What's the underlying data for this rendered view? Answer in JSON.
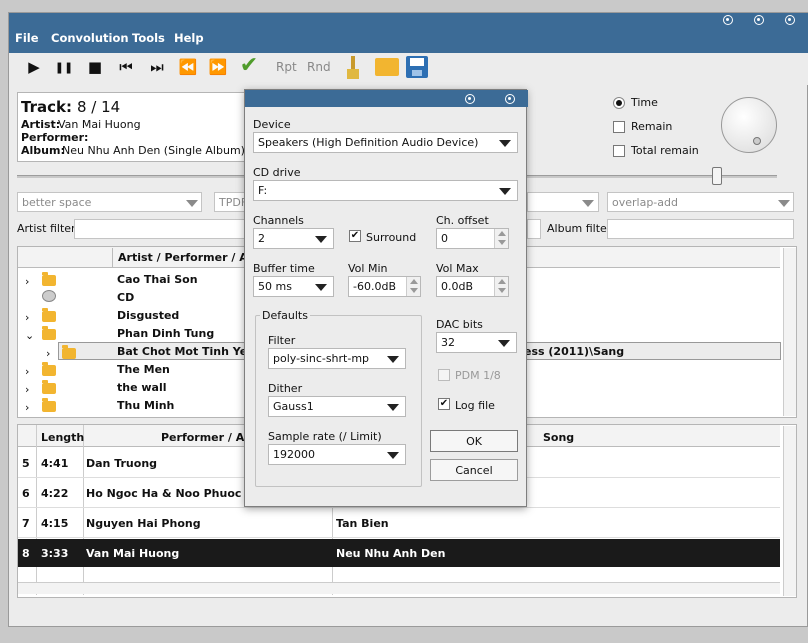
{
  "menu": [
    "File",
    "Convolution",
    "Tools",
    "Help"
  ],
  "toolbar": {
    "play": "▶",
    "pause": "❚❚",
    "stop": "■",
    "prev": "⏮",
    "next": "⏭",
    "rewind": "⏪",
    "forward": "⏩",
    "check": "✔",
    "repeat": "Rpt",
    "random": "Rnd"
  },
  "track": {
    "label": "Track:",
    "number": "8 / 14",
    "artist_label": "Artist:",
    "artist": "Van Mai Huong",
    "performer_label": "Performer:",
    "performer": "",
    "album_label": "Album:",
    "album": "Neu Nhu Anh Den (Single Album)"
  },
  "time_options": [
    "Time",
    "Remain",
    "Total remain"
  ],
  "combos": {
    "left": "better space",
    "tpdf": "TPDF",
    "right": "overlap-add"
  },
  "filters": {
    "artist_filter": "Artist filter",
    "album_filter": "Album filter"
  },
  "tree": {
    "header": "Artist / Performer / Album",
    "rows": [
      "Cao Thai Son",
      "CD",
      "Disgusted",
      "Phan Dinh Tung",
      "Bat Chot Mot Tinh Yeu",
      "The Men",
      "the wall",
      "Thu Minh"
    ],
    "path_fragment": "ess (2011)\\Sang"
  },
  "playlist": {
    "headers": [
      "Length",
      "Performer / Artist",
      "Song"
    ],
    "rows": [
      {
        "n": "5",
        "len": "4:41",
        "artist": "Dan Truong",
        "song": ""
      },
      {
        "n": "6",
        "len": "4:22",
        "artist": "Ho Ngoc Ha & Noo Phuoc Thinh",
        "song": ""
      },
      {
        "n": "7",
        "len": "4:15",
        "artist": "Nguyen Hai Phong",
        "song": "Tan Bien"
      },
      {
        "n": "8",
        "len": "3:33",
        "artist": "Van Mai Huong",
        "song": "Neu Nhu Anh Den"
      }
    ]
  },
  "dialog": {
    "device_label": "Device",
    "device": "Speakers (High Definition Audio Device)",
    "cd_label": "CD drive",
    "cd": "F:",
    "channels_label": "Channels",
    "channels": "2",
    "surround_label": "Surround",
    "ch_offset_label": "Ch. offset",
    "ch_offset": "0",
    "buffer_label": "Buffer time",
    "buffer": "50 ms",
    "volmin_label": "Vol Min",
    "volmin": "-60.0dB",
    "volmax_label": "Vol Max",
    "volmax": "0.0dB",
    "defaults_label": "Defaults",
    "filter_label": "Filter",
    "filter": "poly-sinc-shrt-mp",
    "dither_label": "Dither",
    "dither": "Gauss1",
    "samplerate_label": "Sample rate (/ Limit)",
    "samplerate": "192000",
    "dac_label": "DAC bits",
    "dac": "32",
    "pdm_label": "PDM 1/8",
    "log_label": "Log file",
    "ok": "OK",
    "cancel": "Cancel"
  },
  "colors": {
    "titlebar": "#3c6b96",
    "selected_row": "#1a1a1a"
  }
}
